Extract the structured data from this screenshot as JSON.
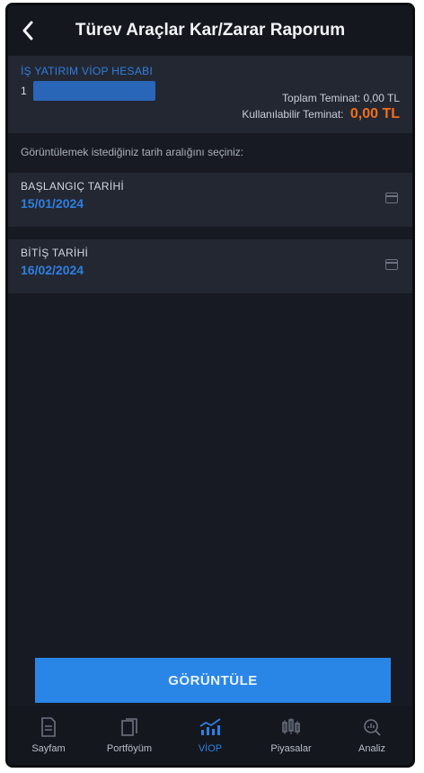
{
  "header": {
    "title": "Türev Araçlar Kar/Zarar Raporum",
    "back_icon": "chevron-left-icon"
  },
  "account": {
    "name": "İŞ YATIRIM VİOP HESABI",
    "number_prefix": "1",
    "total_label": "Toplam Teminat:",
    "total_value": "0,00 TL",
    "usable_label": "Kullanılabilir Teminat:",
    "usable_value": "0,00 TL"
  },
  "hint": "Görüntülemek istediğiniz tarih aralığını seçiniz:",
  "start_date": {
    "label": "BAŞLANGIÇ TARİHİ",
    "value": "15/01/2024"
  },
  "end_date": {
    "label": "BİTİŞ TARİHİ",
    "value": "16/02/2024"
  },
  "action": {
    "label": "GÖRÜNTÜLE"
  },
  "tabs": [
    {
      "label": "Sayfam",
      "icon": "document-icon",
      "active": false
    },
    {
      "label": "Portföyüm",
      "icon": "portfolio-icon",
      "active": false
    },
    {
      "label": "VİOP",
      "icon": "chart-icon",
      "active": true
    },
    {
      "label": "Piyasalar",
      "icon": "markets-icon",
      "active": false
    },
    {
      "label": "Analiz",
      "icon": "analysis-icon",
      "active": false
    }
  ],
  "colors": {
    "background": "#171a22",
    "accent": "#2f7fe0",
    "highlight": "#f06f1a",
    "button": "#2a86e6"
  }
}
